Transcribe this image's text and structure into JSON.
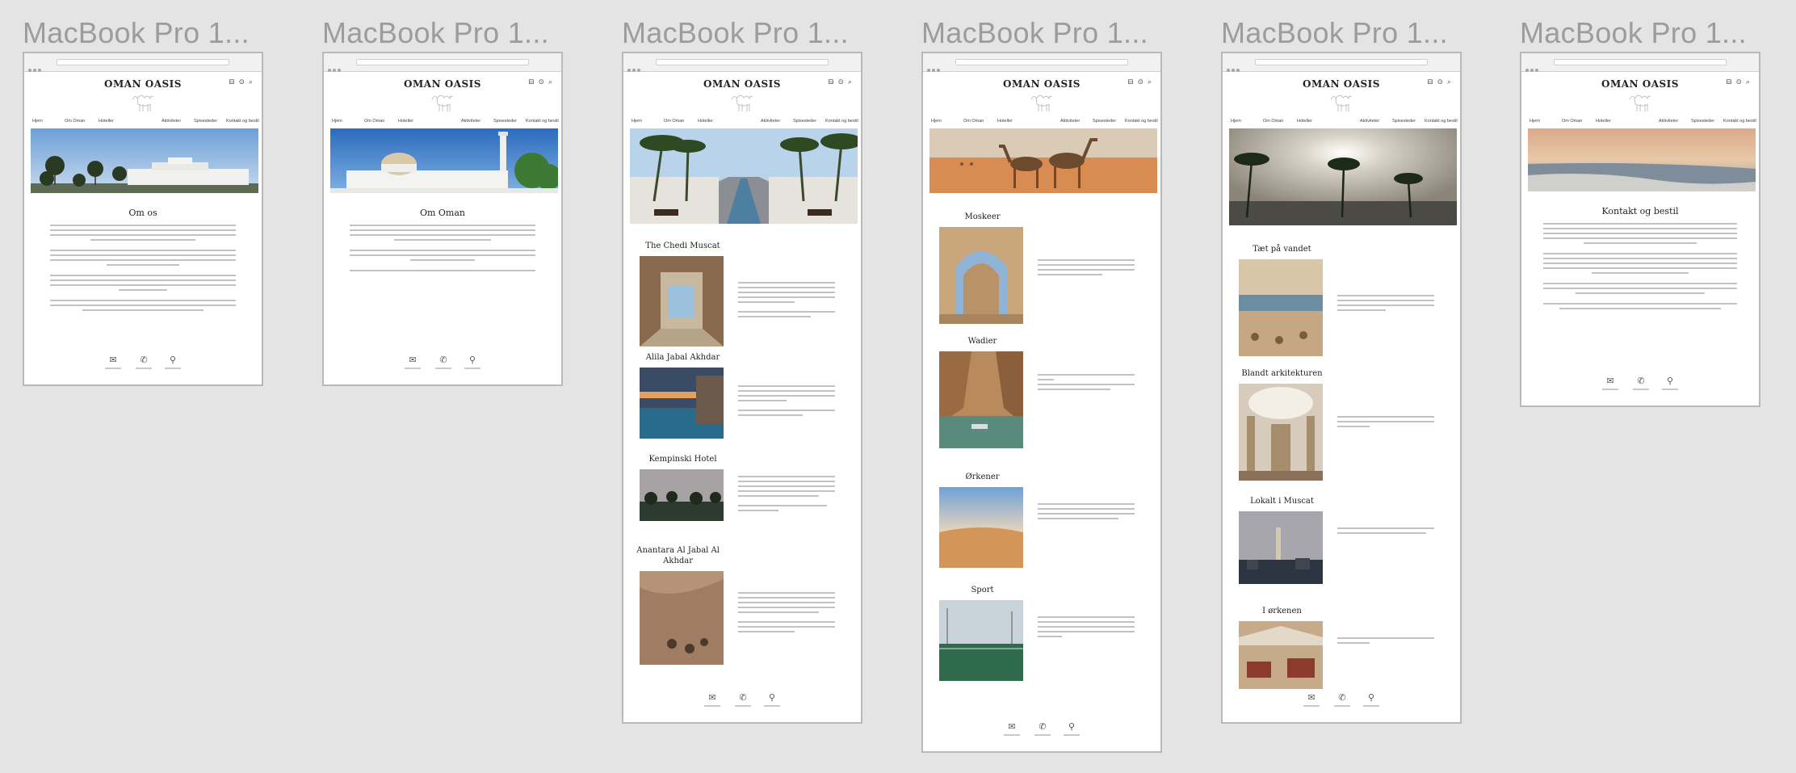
{
  "frames": [
    {
      "title": "MacBook Pro 1...",
      "section_title": "Om os"
    },
    {
      "title": "MacBook Pro 1...",
      "section_title": "Om Oman"
    },
    {
      "title": "MacBook Pro 1...",
      "rows": [
        "The Chedi Muscat",
        "Alila Jabal Akhdar",
        "Kempinski Hotel",
        "Anantara Al Jabal Al Akhdar"
      ]
    },
    {
      "title": "MacBook Pro 1...",
      "rows": [
        "Moskeer",
        "Wadier",
        "Ørkener",
        "Sport"
      ]
    },
    {
      "title": "MacBook Pro 1...",
      "rows": [
        "Tæt på vandet",
        "Blandt arkitekturen",
        "Lokalt i Muscat",
        "I ørkenen"
      ]
    },
    {
      "title": "MacBook Pro 1...",
      "section_title": "Kontakt og bestil"
    }
  ],
  "site": {
    "logo": "OMAN OASIS",
    "header_icons": "⊟ ⊙ ⌕",
    "nav": [
      "Hjem",
      "Om Oman",
      "Hoteller",
      "Aktiviteter",
      "Spisesteder",
      "Kontakt og bestil"
    ]
  },
  "icons": {
    "mail": "mail-icon",
    "phone": "phone-icon",
    "location": "location-pin-icon",
    "camel": "camel-logo-icon",
    "glyphs": {
      "mail": "✉",
      "phone": "✆",
      "location": "⚲"
    }
  }
}
